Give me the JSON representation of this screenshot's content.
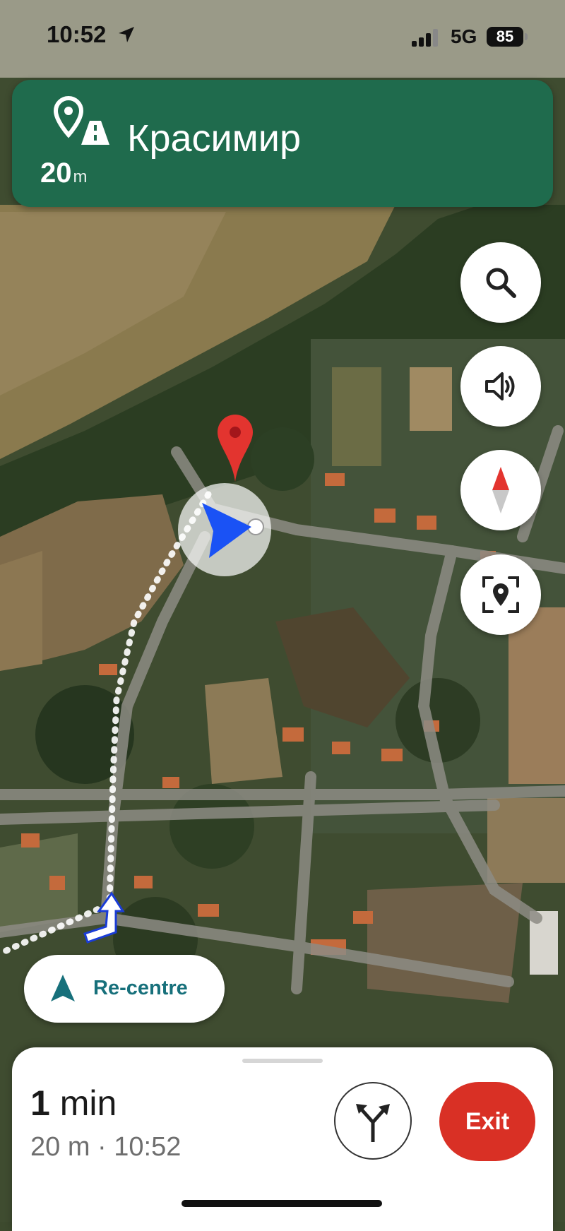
{
  "status_bar": {
    "time": "10:52",
    "network": "5G",
    "battery": "85"
  },
  "banner": {
    "distance_value": "20",
    "distance_unit": "m",
    "street": "Красимир",
    "color": "#1f6b4d"
  },
  "controls": {
    "search_icon": "search-icon",
    "sound_icon": "speaker-icon",
    "compass_icon": "compass-icon",
    "report_icon": "report-location-icon"
  },
  "recentre": {
    "label": "Re-centre"
  },
  "trip": {
    "eta_value": "1",
    "eta_unit": "min",
    "details": "20 m · 10:52",
    "exit_label": "Exit",
    "exit_color": "#d93025"
  }
}
